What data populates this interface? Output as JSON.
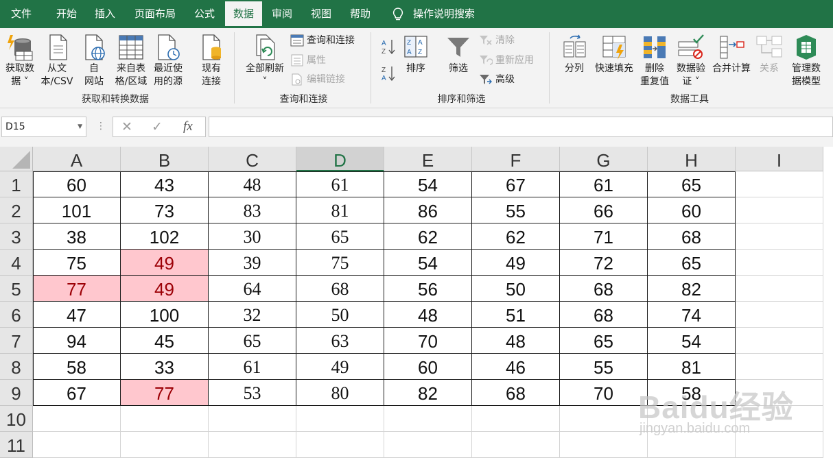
{
  "tabs": [
    "文件",
    "开始",
    "插入",
    "页面布局",
    "公式",
    "数据",
    "审阅",
    "视图",
    "帮助"
  ],
  "active_tab": "数据",
  "tell_me": "操作说明搜索",
  "ribbon": {
    "get_data": {
      "line1": "获取数",
      "line2": "据 ˅"
    },
    "from_csv": {
      "line1": "从文",
      "line2": "本/CSV"
    },
    "from_web": {
      "line1": "自",
      "line2": "网站"
    },
    "from_table": {
      "line1": "来自表",
      "line2": "格/区域"
    },
    "recent_sources": {
      "line1": "最近使",
      "line2": "用的源"
    },
    "existing_conn": {
      "line1": "现有",
      "line2": "连接"
    },
    "group1_label": "获取和转换数据",
    "refresh_all": {
      "line1": "全部刷新",
      "line2": "˅"
    },
    "queries_conn": "查询和连接",
    "properties": "属性",
    "edit_links": "编辑链接",
    "group2_label": "查询和连接",
    "sort": "排序",
    "filter": "筛选",
    "clear": "清除",
    "reapply": "重新应用",
    "advanced": "高级",
    "group3_label": "排序和筛选",
    "text_to_columns": "分列",
    "flash_fill": "快速填充",
    "remove_dup": {
      "line1": "删除",
      "line2": "重复值"
    },
    "data_validation": {
      "line1": "数据验",
      "line2": "证 ˅"
    },
    "consolidate": "合并计算",
    "relationships": "关系",
    "data_model": {
      "line1": "管理数",
      "line2": "据模型"
    },
    "group4_label": "数据工具"
  },
  "formula_bar": {
    "name_box": "D15",
    "cancel": "✕",
    "enter": "✓",
    "fx": "fx",
    "formula": ""
  },
  "columns": [
    "A",
    "B",
    "C",
    "D",
    "E",
    "F",
    "G",
    "H",
    "I"
  ],
  "selected_column": "D",
  "rows": [
    "1",
    "2",
    "3",
    "4",
    "5",
    "6",
    "7",
    "8",
    "9",
    "10",
    "11"
  ],
  "table": [
    [
      "60",
      "43",
      "48",
      "61",
      "54",
      "67",
      "61",
      "65"
    ],
    [
      "101",
      "73",
      "83",
      "81",
      "86",
      "55",
      "66",
      "60"
    ],
    [
      "38",
      "102",
      "30",
      "65",
      "62",
      "62",
      "71",
      "68"
    ],
    [
      "75",
      "49",
      "39",
      "75",
      "54",
      "49",
      "72",
      "65"
    ],
    [
      "77",
      "49",
      "64",
      "68",
      "56",
      "50",
      "68",
      "82"
    ],
    [
      "47",
      "100",
      "32",
      "50",
      "48",
      "51",
      "68",
      "74"
    ],
    [
      "94",
      "45",
      "65",
      "63",
      "70",
      "48",
      "65",
      "54"
    ],
    [
      "58",
      "33",
      "61",
      "49",
      "60",
      "46",
      "55",
      "81"
    ],
    [
      "67",
      "77",
      "53",
      "80",
      "82",
      "68",
      "70",
      "58"
    ]
  ],
  "highlighted_cells": [
    "B4",
    "A5",
    "B5",
    "B9"
  ],
  "colors": {
    "ribbon_green": "#217346",
    "highlight_fill": "#ffc7ce",
    "highlight_text": "#9c0006"
  },
  "watermark": {
    "text": "Baidu经验",
    "sub": "jingyan.baidu.com"
  }
}
